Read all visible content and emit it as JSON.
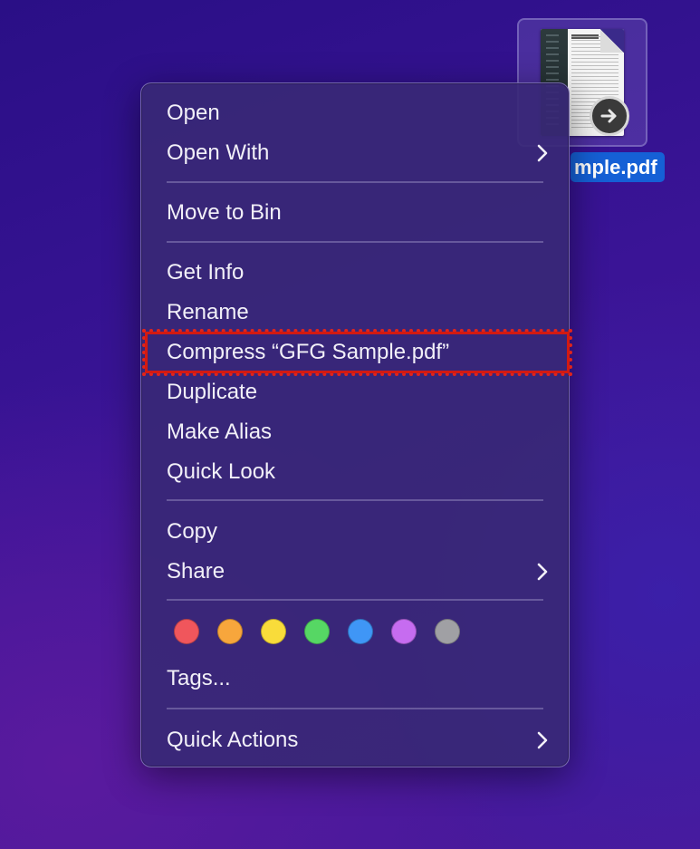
{
  "desktop_file": {
    "label": "mple.pdf",
    "icon": "pdf-document-thumbnail",
    "badge_icon": "arrow-right-circle-icon"
  },
  "menu": {
    "items": [
      {
        "label": "Open"
      },
      {
        "label": "Open With",
        "submenu": true
      },
      {
        "label": "Move to Bin"
      },
      {
        "label": "Get Info"
      },
      {
        "label": "Rename"
      },
      {
        "label": "Compress “GFG Sample.pdf”",
        "highlighted": true
      },
      {
        "label": "Duplicate"
      },
      {
        "label": "Make Alias"
      },
      {
        "label": "Quick Look"
      },
      {
        "label": "Copy"
      },
      {
        "label": "Share",
        "submenu": true
      },
      {
        "label": "Tags..."
      },
      {
        "label": "Quick Actions",
        "submenu": true
      }
    ],
    "tag_colors": [
      {
        "name": "red",
        "hex": "#f0565c"
      },
      {
        "name": "orange",
        "hex": "#f7a63c"
      },
      {
        "name": "yellow",
        "hex": "#f9dc3a"
      },
      {
        "name": "green",
        "hex": "#56d764"
      },
      {
        "name": "blue",
        "hex": "#3f96f6"
      },
      {
        "name": "purple",
        "hex": "#c66cf0"
      },
      {
        "name": "gray",
        "hex": "#a0a0a4"
      }
    ]
  },
  "colors": {
    "highlight": "#e0241b",
    "selection": "#1560d6",
    "menu_text": "#f2f0f8"
  }
}
